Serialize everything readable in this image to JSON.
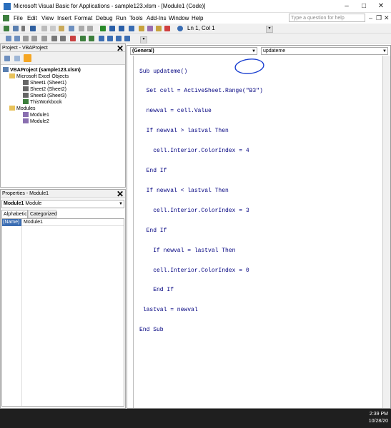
{
  "window": {
    "title": "Microsoft Visual Basic for Applications - sample123.xlsm - [Module1 (Code)]",
    "minimize": "–",
    "maximize": "□",
    "close": "✕"
  },
  "menu": {
    "items": [
      "File",
      "Edit",
      "View",
      "Insert",
      "Format",
      "Debug",
      "Run",
      "Tools",
      "Add-Ins",
      "Window",
      "Help"
    ],
    "help_placeholder": "Type a question for help",
    "mdi_close": "✕"
  },
  "toolbar": {
    "position": "Ln 1, Col 1"
  },
  "project": {
    "title": "Project - VBAProject",
    "close": "✕",
    "tree": [
      {
        "label": "VBAProject (sample123.xlsm)",
        "level": 0,
        "bold": true
      },
      {
        "label": "Microsoft Excel Objects",
        "level": 1
      },
      {
        "label": "Sheet1 (Sheet1)",
        "level": 2
      },
      {
        "label": "Sheet2 (Sheet2)",
        "level": 2
      },
      {
        "label": "Sheet3 (Sheet3)",
        "level": 2
      },
      {
        "label": "ThisWorkbook",
        "level": 2
      },
      {
        "label": "Modules",
        "level": 1
      },
      {
        "label": "Module1",
        "level": 2
      },
      {
        "label": "Module2",
        "level": 2
      }
    ]
  },
  "properties": {
    "title": "Properties - Module1",
    "close": "✕",
    "object_name": "Module1",
    "object_type": "Module",
    "tabs": [
      "Alphabetic",
      "Categorized"
    ],
    "rows": [
      {
        "name": "(Name)",
        "value": "Module1"
      }
    ]
  },
  "code": {
    "object_combo": "(General)",
    "proc_combo": "updateme",
    "lines": [
      "Sub updateme()",
      "  Set cell = ActiveSheet.Range(\"B3\")",
      "  newval = cell.Value",
      "  If newval > lastval Then",
      "    cell.Interior.ColorIndex = 4",
      "  End If",
      "  If newval < lastval Then",
      "    cell.Interior.ColorIndex = 3",
      "  End If",
      "    If newval = lastval Then",
      "    cell.Interior.ColorIndex = 0",
      "    End If",
      " lastval = newval",
      "End Sub"
    ]
  },
  "taskbar": {
    "time": "2:39 PM",
    "date": "10/28/20"
  }
}
